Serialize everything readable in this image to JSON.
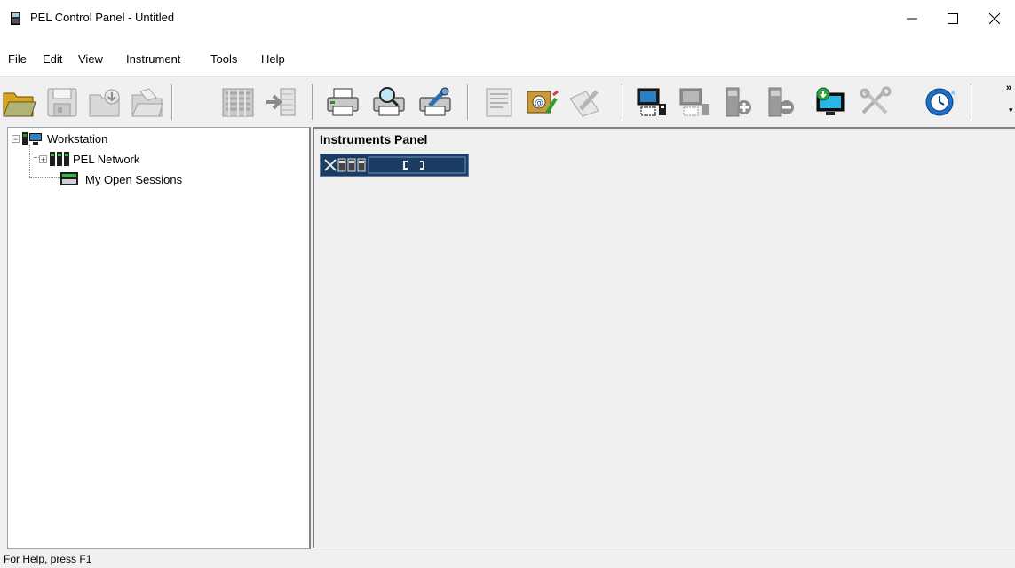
{
  "window": {
    "title": "PEL Control Panel - Untitled"
  },
  "menu": [
    "File",
    "Edit",
    "View",
    "Instrument",
    "Tools",
    "Help"
  ],
  "toolbar": {
    "buttons": [
      "open-folder-icon",
      "save-disk-icon",
      "download-folder-icon",
      "open-folder-gray-icon",
      "import-icon",
      "import-arrow-icon",
      "print-icon",
      "print-preview-icon",
      "print-setup-icon",
      "report-icon",
      "email-icon",
      "edit-note-icon",
      "connect-instrument-icon",
      "disconnect-instrument-icon",
      "add-instrument-icon",
      "remove-instrument-icon",
      "download-monitor-icon",
      "tools-icon",
      "sync-clock-icon"
    ]
  },
  "tree": {
    "root": "Workstation",
    "children": [
      "PEL Network",
      "My Open Sessions"
    ]
  },
  "instruments_panel": {
    "title": "Instruments Panel"
  },
  "status": {
    "text": "For Help, press F1"
  }
}
